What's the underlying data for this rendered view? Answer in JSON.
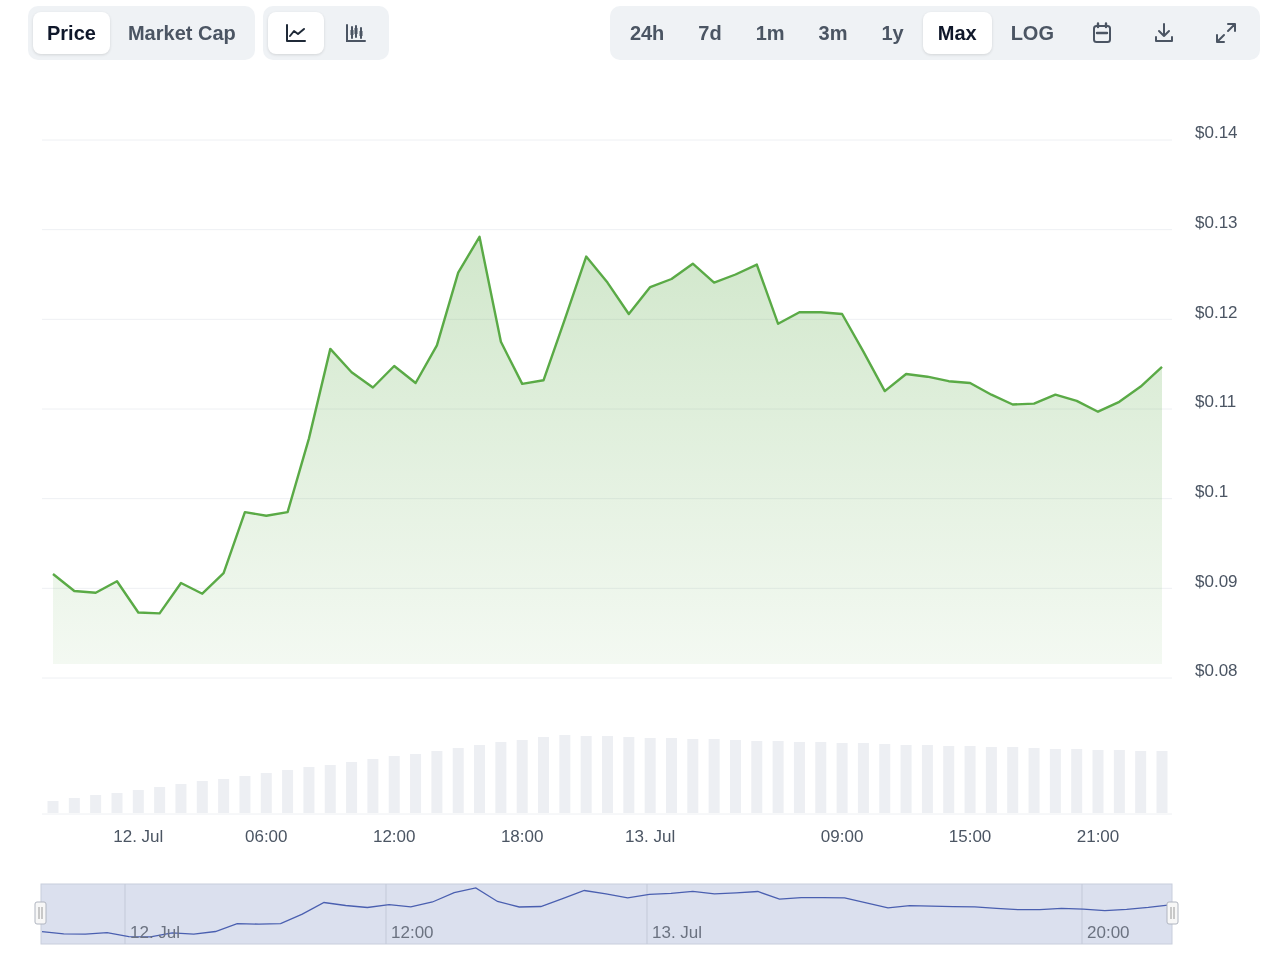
{
  "metric_tabs": [
    {
      "label": "Price",
      "selected": true
    },
    {
      "label": "Market Cap",
      "selected": false
    }
  ],
  "chart_style_toggle": [
    {
      "kind": "line",
      "selected": true
    },
    {
      "kind": "candlestick",
      "selected": false
    }
  ],
  "range_tabs": [
    {
      "label": "24h",
      "selected": false
    },
    {
      "label": "7d",
      "selected": false
    },
    {
      "label": "1m",
      "selected": false
    },
    {
      "label": "3m",
      "selected": false
    },
    {
      "label": "1y",
      "selected": false
    },
    {
      "label": "Max",
      "selected": true
    }
  ],
  "log_toggle": {
    "label": "LOG",
    "selected": false
  },
  "tools": [
    {
      "kind": "calendar"
    },
    {
      "kind": "download"
    },
    {
      "kind": "fullscreen"
    }
  ],
  "price_chart": {
    "chart_data": {
      "type": "area",
      "grid": true,
      "series": [
        {
          "color": "#5aaa46",
          "values": [
            0.0916,
            0.0897,
            0.0895,
            0.0908,
            0.0873,
            0.0872,
            0.0906,
            0.0894,
            0.0917,
            0.0985,
            0.0981,
            0.0985,
            0.1067,
            0.1167,
            0.1141,
            0.1124,
            0.1148,
            0.1129,
            0.1171,
            0.1252,
            0.1292,
            0.1175,
            0.1128,
            0.1132,
            0.12,
            0.127,
            0.1241,
            0.1206,
            0.1236,
            0.1245,
            0.1262,
            0.1241,
            0.125,
            0.1261,
            0.1195,
            0.1208,
            0.1208,
            0.1206,
            0.1164,
            0.112,
            0.1139,
            0.1136,
            0.1131,
            0.1129,
            0.1116,
            0.1105,
            0.1106,
            0.1116,
            0.1109,
            0.1097,
            0.1108,
            0.1125,
            0.1147
          ]
        }
      ],
      "ylim": [
        0.08,
        0.14
      ],
      "yticks": [
        {
          "value": 0.14,
          "label": "$0.14"
        },
        {
          "value": 0.13,
          "label": "$0.13"
        },
        {
          "value": 0.12,
          "label": "$0.12"
        },
        {
          "value": 0.11,
          "label": "$0.11"
        },
        {
          "value": 0.1,
          "label": "$0.1"
        },
        {
          "value": 0.09,
          "label": "$0.09"
        },
        {
          "value": 0.08,
          "label": "$0.08"
        }
      ]
    },
    "x_axis_labels": [
      "12. Jul",
      "06:00",
      "12:00",
      "18:00",
      "13. Jul",
      "09:00",
      "15:00",
      "21:00"
    ]
  },
  "navigator": {
    "labels": [
      "12. Jul",
      "12:00",
      "13. Jul",
      "20:00"
    ]
  }
}
